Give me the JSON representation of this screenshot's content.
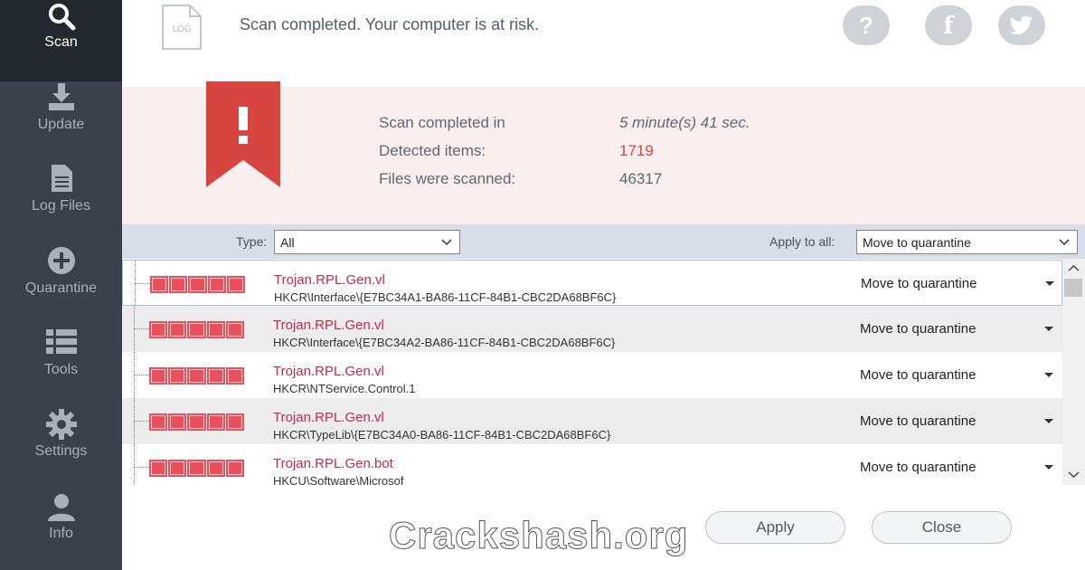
{
  "sidebar": {
    "items": [
      {
        "label": "Scan",
        "icon": "search-icon"
      },
      {
        "label": "Update",
        "icon": "download-icon"
      },
      {
        "label": "Log Files",
        "icon": "file-icon"
      },
      {
        "label": "Quarantine",
        "icon": "plus-circle-icon"
      },
      {
        "label": "Tools",
        "icon": "list-icon"
      },
      {
        "label": "Settings",
        "icon": "gear-icon"
      },
      {
        "label": "Info",
        "icon": "user-icon"
      }
    ]
  },
  "header": {
    "log_icon_text": "LOG",
    "status": "Scan completed. Your computer is at risk.",
    "help_glyph": "?",
    "facebook_glyph": "f"
  },
  "summary": {
    "rows": [
      {
        "label": "Scan completed in",
        "value": "5 minute(s) 41 sec."
      },
      {
        "label": "Detected items:",
        "value": "1719"
      },
      {
        "label": "Files were scanned:",
        "value": "46317"
      }
    ]
  },
  "filters": {
    "type_label": "Type:",
    "type_value": "All",
    "apply_all_label": "Apply to all:",
    "apply_all_value": "Move to quarantine"
  },
  "threats": [
    {
      "name": "Trojan.RPL.Gen.vl",
      "path": "HKCR\\Interface\\{E7BC34A1-BA86-11CF-84B1-CBC2DA68BF6C}",
      "action": "Move to quarantine"
    },
    {
      "name": "Trojan.RPL.Gen.vl",
      "path": "HKCR\\Interface\\{E7BC34A2-BA86-11CF-84B1-CBC2DA68BF6C}",
      "action": "Move to quarantine"
    },
    {
      "name": "Trojan.RPL.Gen.vl",
      "path": "HKCR\\NTService.Control.1",
      "action": "Move to quarantine"
    },
    {
      "name": "Trojan.RPL.Gen.vl",
      "path": "HKCR\\TypeLib\\{E7BC34A0-BA86-11CF-84B1-CBC2DA68BF6C}",
      "action": "Move to quarantine"
    },
    {
      "name": "Trojan.RPL.Gen.bot",
      "path": "HKCU\\Software\\Microsof",
      "action": "Move to quarantine"
    }
  ],
  "footer": {
    "apply_label": "Apply",
    "close_label": "Close",
    "watermark": "Crackshash.org"
  },
  "colors": {
    "sidebar": "#3b414a",
    "sidebar_active": "#23282e",
    "alert_red": "#d6453f",
    "threat_name": "#c8284a",
    "summary_bg": "#fbeeee"
  }
}
